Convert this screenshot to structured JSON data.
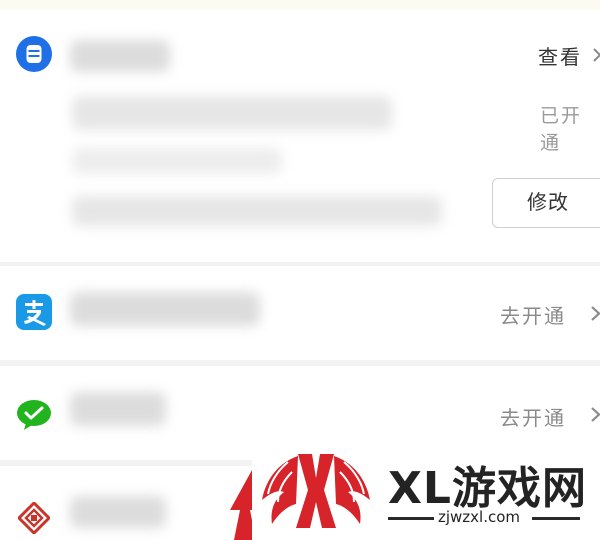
{
  "accounts": [
    {
      "name": "bank-card",
      "icon": "bank-card-icon",
      "action": "查看",
      "status": "已开通",
      "modify_label": "修改"
    },
    {
      "name": "alipay",
      "icon": "alipay-icon",
      "action": "去开通"
    },
    {
      "name": "wechat-pay",
      "icon": "wechat-pay-icon",
      "action": "去开通"
    },
    {
      "name": "unionpay",
      "icon": "unionpay-icon"
    }
  ],
  "watermark": {
    "title": "XL游戏网",
    "url": "zjwzxl.com"
  },
  "colors": {
    "bank_blue": "#1f6fe6",
    "alipay_blue": "#1a9ae6",
    "wechat_green": "#22b41e",
    "unionpay_red": "#c9352b",
    "watermark_red": "#d7232a"
  }
}
